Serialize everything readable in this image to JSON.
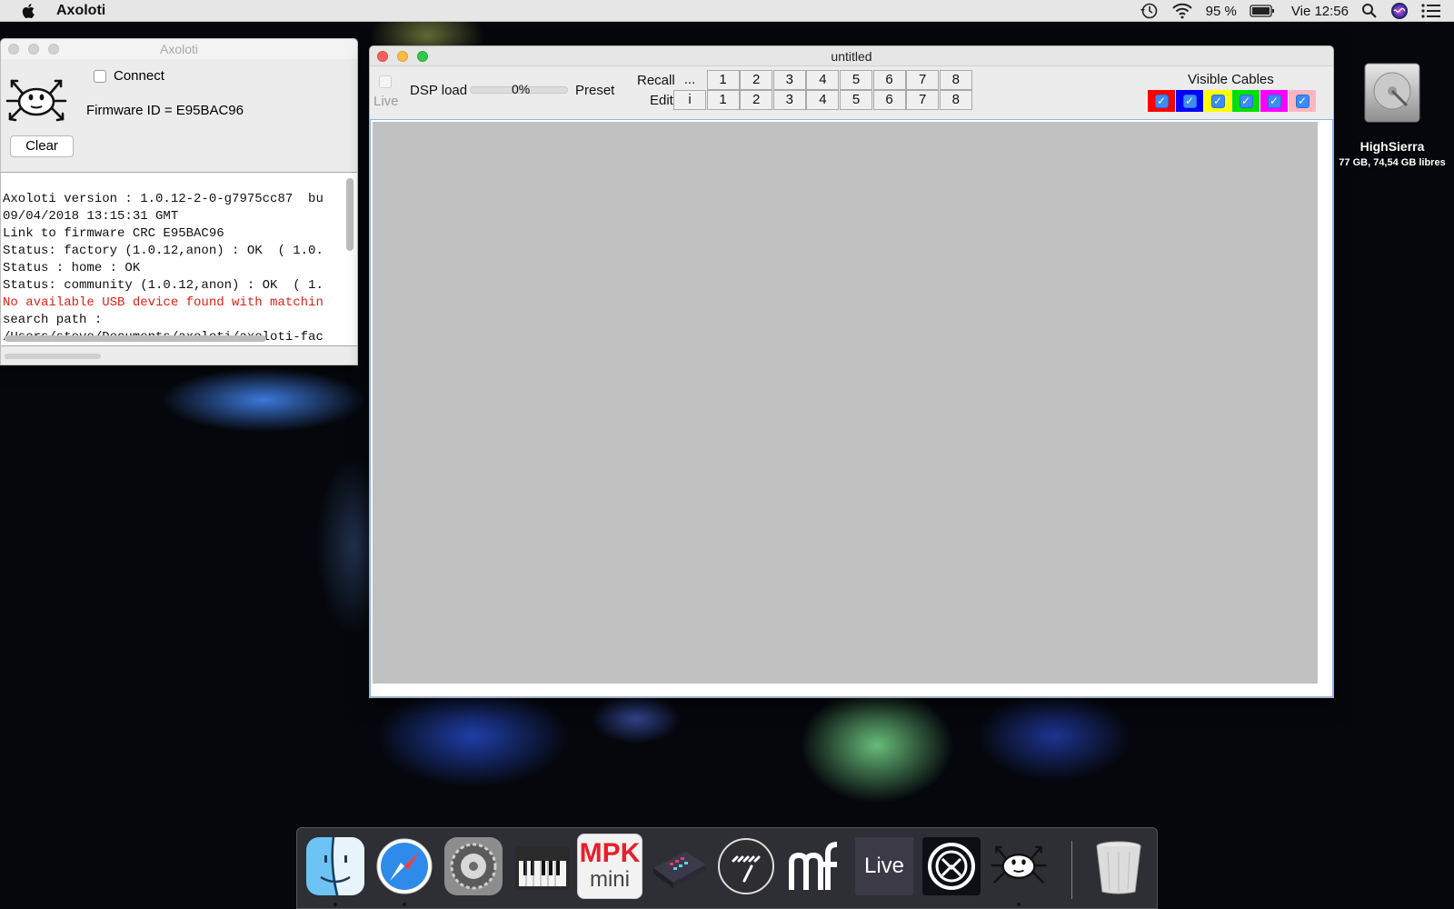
{
  "menubar": {
    "app_name": "Axoloti",
    "battery": "95 %",
    "clock": "Vie 12:56",
    "icons": [
      "apple-icon",
      "time-machine-icon",
      "wifi-icon",
      "battery-icon",
      "spotlight-icon",
      "siri-icon",
      "notification-center-icon"
    ]
  },
  "axoloti_window": {
    "title": "Axoloti",
    "connect_label": "Connect",
    "firmware": "Firmware ID = E95BAC96",
    "clear_label": "Clear",
    "log": [
      {
        "text": "Axoloti version : 1.0.12-2-0-g7975cc87  bu",
        "error": false
      },
      {
        "text": "09/04/2018 13:15:31 GMT",
        "error": false
      },
      {
        "text": "Link to firmware CRC E95BAC96",
        "error": false
      },
      {
        "text": "Status: factory (1.0.12,anon) : OK  ( 1.0.",
        "error": false
      },
      {
        "text": "Status : home : OK",
        "error": false
      },
      {
        "text": "Status: community (1.0.12,anon) : OK  ( 1.",
        "error": false
      },
      {
        "text": "No available USB device found with matchin",
        "error": true
      },
      {
        "text": "search path :",
        "error": false
      },
      {
        "text": "/Users/steve/Documents/axoloti/axoloti-fac",
        "error": false
      }
    ]
  },
  "patch_window": {
    "title": "untitled",
    "live_label": "Live",
    "dsp_label": "DSP load",
    "dsp_value": "0%",
    "dsp_fraction": 0.0,
    "preset_label": "Preset",
    "recall_label": "Recall",
    "edit_label": "Edit",
    "recall_buttons": [
      "...",
      "1",
      "2",
      "3",
      "4",
      "5",
      "6",
      "7",
      "8"
    ],
    "edit_buttons": [
      "i",
      "1",
      "2",
      "3",
      "4",
      "5",
      "6",
      "7",
      "8"
    ],
    "visible_cables_label": "Visible Cables",
    "cable_colors": [
      "#ff0000",
      "#0000ff",
      "#ffff00",
      "#00e000",
      "#ff00ff",
      "#ffb6c1"
    ]
  },
  "desktop": {
    "drive_name": "HighSierra",
    "drive_info": "77 GB, 74,54 GB libres"
  },
  "dock": {
    "items": [
      "finder-icon",
      "safari-icon",
      "system-preferences-icon",
      "keyboard-app-icon",
      "mpk-mini-icon",
      "mpc-app-icon",
      "melodyne-icon",
      "mfi-app-icon",
      "ableton-live-icon",
      "traktor-icon",
      "axoloti-icon",
      "trash-icon"
    ],
    "mpk_text_1": "MPK",
    "mpk_text_2": "mini",
    "live_text": "Live"
  }
}
